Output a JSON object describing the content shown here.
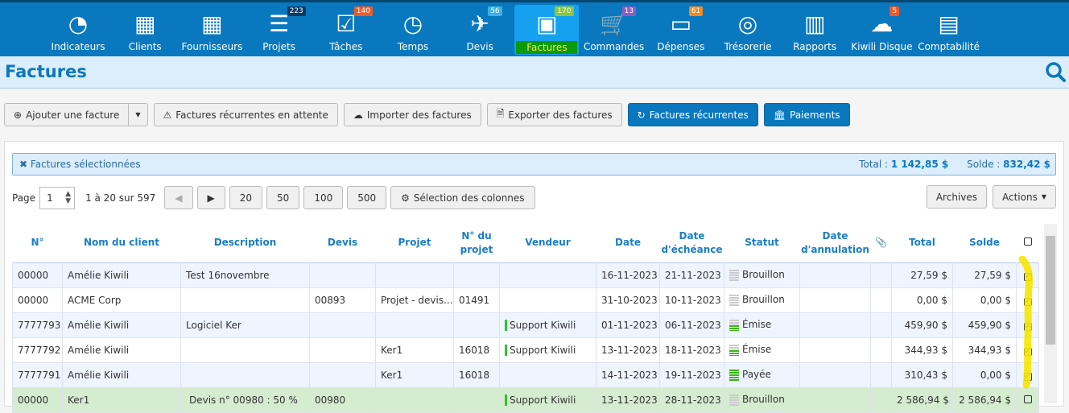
{
  "nav": [
    {
      "label": "Indicateurs",
      "icon": "dashboard-icon",
      "glyph": "◔"
    },
    {
      "label": "Clients",
      "icon": "building-icon",
      "glyph": "▦"
    },
    {
      "label": "Fournisseurs",
      "icon": "building-icon",
      "glyph": "▦"
    },
    {
      "label": "Projets",
      "icon": "projects-icon",
      "glyph": "☰",
      "badge": "223",
      "badge_color": "#0b3a66"
    },
    {
      "label": "Tâches",
      "icon": "check-icon",
      "glyph": "☑",
      "badge": "140",
      "badge_color": "#f05a28"
    },
    {
      "label": "Temps",
      "icon": "clock-icon",
      "glyph": "◷"
    },
    {
      "label": "Devis",
      "icon": "paper-plane-icon",
      "glyph": "✈",
      "badge": "56",
      "badge_color": "#3fb0e8"
    },
    {
      "label": "Factures",
      "icon": "money-icon",
      "glyph": "▣",
      "badge": "170",
      "badge_color": "#8cc63f",
      "active": true
    },
    {
      "label": "Commandes",
      "icon": "cart-icon",
      "glyph": "🛒",
      "badge": "13",
      "badge_color": "#8e5bc2"
    },
    {
      "label": "Dépenses",
      "icon": "credit-card-icon",
      "glyph": "▭",
      "badge": "61",
      "badge_color": "#f08a1e"
    },
    {
      "label": "Trésorerie",
      "icon": "compass-icon",
      "glyph": "◎"
    },
    {
      "label": "Rapports",
      "icon": "bar-chart-icon",
      "glyph": "▥"
    },
    {
      "label": "Kiwili Disque",
      "icon": "cloud-icon",
      "glyph": "☁",
      "badge": "5",
      "badge_color": "#f05a28"
    },
    {
      "label": "Comptabilité",
      "icon": "book-icon",
      "glyph": "▤"
    }
  ],
  "page": {
    "title": "Factures"
  },
  "toolbar": {
    "add": "Ajouter une facture",
    "pending": "Factures récurrentes en attente",
    "import": "Importer des factures",
    "export": "Exporter des factures",
    "recurring": "Factures récurrentes",
    "payments": "Paiements"
  },
  "selection": {
    "label": "Factures sélectionnées",
    "total_label": "Total :",
    "total": "1 142,85 $",
    "solde_label": "Solde :",
    "solde": "832,42 $"
  },
  "pager": {
    "page_label": "Page",
    "page": "1",
    "range": "1 à 20 sur 597",
    "sizes": [
      "20",
      "50",
      "100",
      "500"
    ],
    "columns": "Sélection des colonnes",
    "archives": "Archives",
    "actions": "Actions"
  },
  "table": {
    "headers": [
      "N°",
      "Nom du client",
      "Description",
      "Devis",
      "Projet",
      "N° du projet",
      "Vendeur",
      "Date",
      "Date d'échéance",
      "Statut",
      "Date d'annulation",
      "",
      "Total",
      "Solde",
      ""
    ],
    "rows": [
      {
        "no": "00000",
        "client": "Amélie Kiwili",
        "desc": "Test 16novembre",
        "devis": "",
        "projet": "",
        "nprojet": "",
        "vendeur": "",
        "date": "16-11-2023",
        "ech": "21-11-2023",
        "statut": "Brouillon",
        "level": 0,
        "annul": "",
        "total": "27,59 $",
        "solde": "27,59 $",
        "checked": true
      },
      {
        "no": "00000",
        "client": "ACME Corp",
        "desc": "",
        "devis": "00893",
        "projet": "Projet - devis...",
        "nprojet": "01491",
        "vendeur": "",
        "date": "31-10-2023",
        "ech": "10-11-2023",
        "statut": "Brouillon",
        "level": 0,
        "annul": "",
        "total": "0,00 $",
        "solde": "0,00 $",
        "checked": true
      },
      {
        "no": "7777793",
        "client": "Amélie Kiwili",
        "desc": "Logiciel Ker",
        "devis": "",
        "projet": "",
        "nprojet": "",
        "vendeur": "Support Kiwili",
        "date": "01-11-2023",
        "ech": "06-11-2023",
        "statut": "Émise",
        "level": 2,
        "annul": "",
        "total": "459,90 $",
        "solde": "459,90 $",
        "checked": true
      },
      {
        "no": "7777792",
        "client": "Amélie Kiwili",
        "desc": "",
        "devis": "",
        "projet": "Ker1",
        "nprojet": "16018",
        "vendeur": "Support Kiwili",
        "date": "13-11-2023",
        "ech": "18-11-2023",
        "statut": "Émise",
        "level": 2,
        "annul": "",
        "total": "344,93 $",
        "solde": "344,93 $",
        "checked": true
      },
      {
        "no": "7777791",
        "client": "Amélie Kiwili",
        "desc": "",
        "devis": "",
        "projet": "Ker1",
        "nprojet": "16018",
        "vendeur": "",
        "date": "14-11-2023",
        "ech": "19-11-2023",
        "statut": "Payée",
        "level": 4,
        "annul": "",
        "total": "310,43 $",
        "solde": "0,00 $",
        "checked": true
      },
      {
        "no": "00000",
        "client": "Ker1",
        "desc": "Devis n° 00980 : 50 %",
        "devis": "00980",
        "projet": "",
        "nprojet": "",
        "vendeur": "Support Kiwili",
        "date": "13-11-2023",
        "ech": "28-11-2023",
        "statut": "Brouillon",
        "level": 0,
        "annul": "",
        "total": "2 586,94 $",
        "solde": "2 586,94 $",
        "checked": false,
        "highlight": "green"
      }
    ]
  },
  "colors": {
    "brand": "#0a78bf",
    "active_label_bg": "#0a9a0a",
    "marker": "#f5e600"
  }
}
